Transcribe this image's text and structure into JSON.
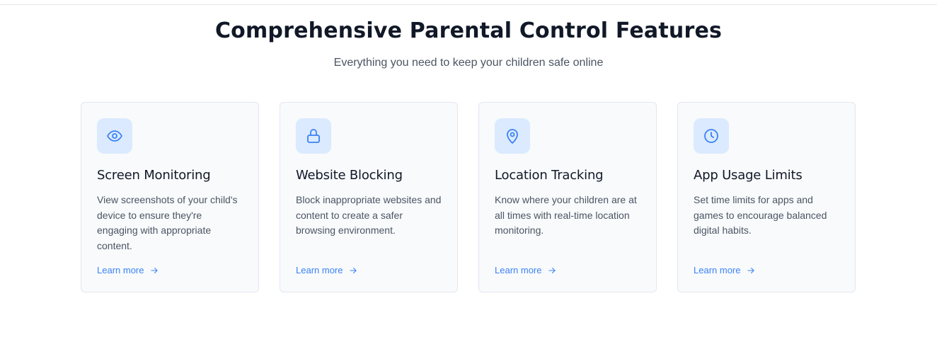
{
  "header": {
    "title": "Comprehensive Parental Control Features",
    "subtitle": "Everything you need to keep your children safe online"
  },
  "theme": {
    "accent": "#3b82f6",
    "icon_tile_bg": "#dbeafe",
    "card_bg": "#f8fafc",
    "card_border": "#e2e8f0"
  },
  "features": [
    {
      "icon": "eye-icon",
      "title": "Screen Monitoring",
      "description": "View screenshots of your child's device to ensure they're engaging with appropriate content.",
      "link_label": "Learn more"
    },
    {
      "icon": "lock-icon",
      "title": "Website Blocking",
      "description": "Block inappropriate websites and content to create a safer browsing environment.",
      "link_label": "Learn more"
    },
    {
      "icon": "map-pin-icon",
      "title": "Location Tracking",
      "description": "Know where your children are at all times with real-time location monitoring.",
      "link_label": "Learn more"
    },
    {
      "icon": "clock-icon",
      "title": "App Usage Limits",
      "description": "Set time limits for apps and games to encourage balanced digital habits.",
      "link_label": "Learn more"
    }
  ]
}
